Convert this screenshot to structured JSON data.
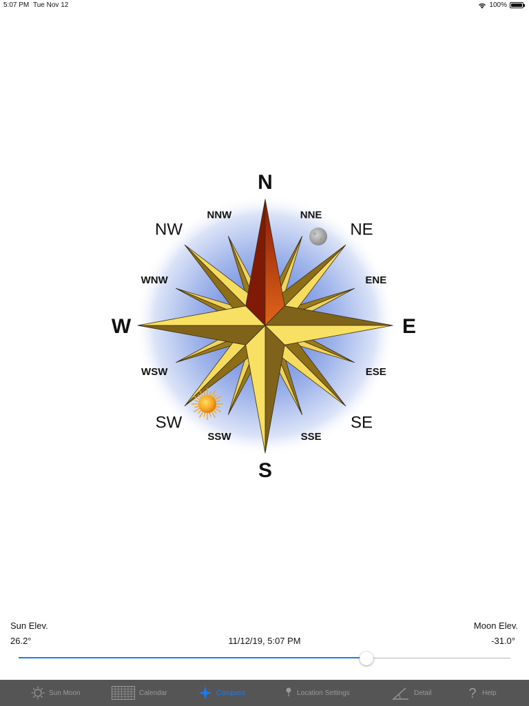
{
  "status_bar": {
    "time": "5:07 PM",
    "date": "Tue Nov 12",
    "battery": "100%"
  },
  "compass": {
    "cardinals": [
      "N",
      "E",
      "S",
      "W"
    ],
    "intercardinals": [
      "NE",
      "SE",
      "SW",
      "NW"
    ],
    "minor": [
      "NNE",
      "ENE",
      "ESE",
      "SSE",
      "SSW",
      "WSW",
      "WNW",
      "NNW"
    ]
  },
  "info": {
    "sun_label": "Sun Elev.",
    "sun_value": "26.2°",
    "moon_label": "Moon Elev.",
    "moon_value": "-31.0°",
    "datetime": "11/12/19, 5:07 PM"
  },
  "slider": {
    "value": 0.707
  },
  "tabs": [
    {
      "label": "Sun Moon",
      "icon": "sun-icon",
      "active": false
    },
    {
      "label": "Calendar",
      "icon": "calendar-icon",
      "active": false
    },
    {
      "label": "Compass",
      "icon": "compass-star-icon",
      "active": true
    },
    {
      "label": "Location Settings",
      "icon": "location-pin-icon",
      "active": false
    },
    {
      "label": "Detail",
      "icon": "angle-icon",
      "active": false
    },
    {
      "label": "Help",
      "icon": "question-icon",
      "active": false
    }
  ],
  "colors": {
    "accent": "#1a7cf5",
    "tab_bar": "#555555"
  }
}
